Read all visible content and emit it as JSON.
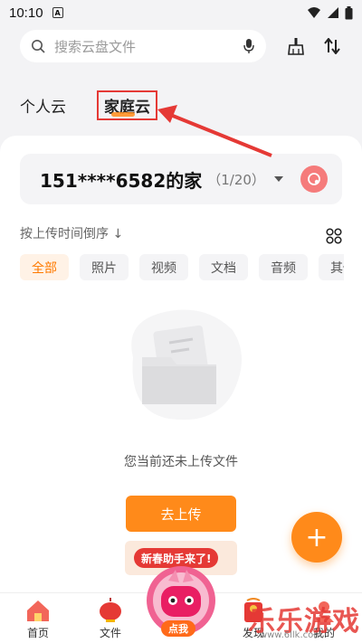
{
  "status_bar": {
    "time": "10:10",
    "notification_letter": "A"
  },
  "search": {
    "placeholder": "搜索云盘文件"
  },
  "tabs": [
    {
      "label": "个人云"
    },
    {
      "label": "家庭云"
    }
  ],
  "family": {
    "name": "151****6582的家",
    "member_count": "（1/20）"
  },
  "sort_label": "按上传时间倒序 ↓",
  "chips": [
    {
      "label": "全部"
    },
    {
      "label": "照片"
    },
    {
      "label": "视频"
    },
    {
      "label": "文档"
    },
    {
      "label": "音频"
    },
    {
      "label": "其他"
    }
  ],
  "empty": {
    "message": "您当前还未上传文件",
    "upload_button": "去上传"
  },
  "fab_label": "+",
  "promo": {
    "banner_text": "新春助手来了!",
    "mascot_button": "点我"
  },
  "bottom_nav": [
    {
      "label": "首页"
    },
    {
      "label": "文件"
    },
    {
      "label": "发现"
    },
    {
      "label": "我的"
    }
  ],
  "watermark": {
    "text": "乐乐游戏",
    "url": "www.6llk.com"
  },
  "colors": {
    "accent": "#ff8a1a",
    "highlight_red": "#e53935"
  }
}
